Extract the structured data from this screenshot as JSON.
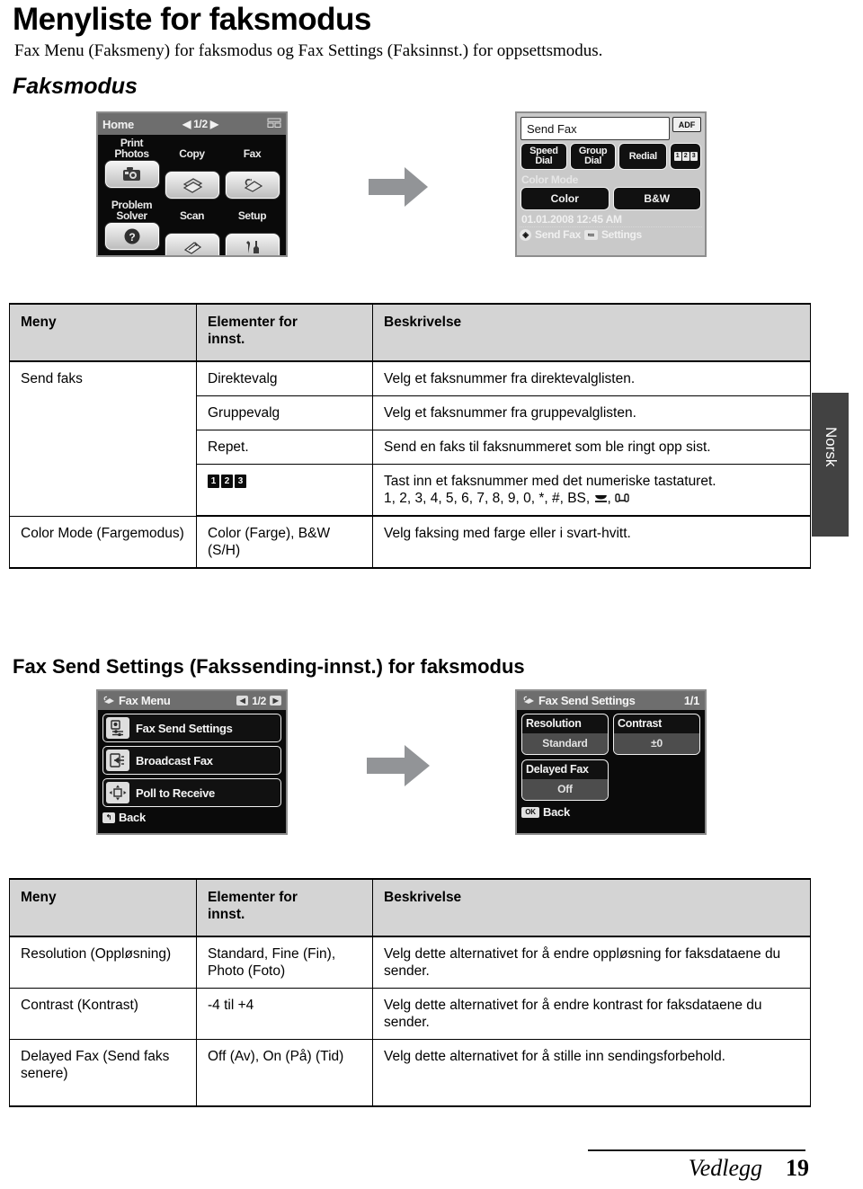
{
  "document": {
    "title": "Menyliste for faksmodus",
    "subtitle": "Fax Menu (Faksmeny) for faksmodus og Fax Settings (Faksinnst.) for oppsettsmodus.",
    "section1_heading": "Faksmodus",
    "section2_heading": "Fax Send Settings (Fakssending-innst.) for faksmodus",
    "side_tab": "Norsk",
    "footer": {
      "label": "Vedlegg",
      "page": "19"
    }
  },
  "lcd_home": {
    "title": "Home",
    "page_indicator": "1/2",
    "prev_arrow": "◀",
    "next_arrow": "▶",
    "items": [
      {
        "label": "Print\nPhotos",
        "icon": "print-photos-icon"
      },
      {
        "label": "Copy",
        "icon": "copy-icon"
      },
      {
        "label": "Fax",
        "icon": "fax-icon"
      },
      {
        "label": "Problem\nSolver",
        "icon": "problem-solver-icon"
      },
      {
        "label": "Scan",
        "icon": "scan-icon"
      },
      {
        "label": "Setup",
        "icon": "setup-icon"
      }
    ]
  },
  "lcd_sendfax": {
    "field_value": "Send Fax",
    "adf_badge": "ADF",
    "keys": [
      {
        "label": "Speed\nDial"
      },
      {
        "label": "Group\nDial"
      },
      {
        "label": "Redial"
      },
      {
        "label": "123"
      }
    ],
    "color_mode_label": "Color Mode",
    "modes": [
      "Color",
      "B&W"
    ],
    "datetime": "01.01.2008  12:45 AM",
    "status_send": "Send Fax",
    "status_settings": "Settings"
  },
  "lcd_faxmenu": {
    "title": "Fax Menu",
    "page_indicator": "1/2",
    "prev_arrow": "◀",
    "next_arrow": "▶",
    "items": [
      {
        "label": "Fax Send Settings",
        "icon": "fax-send-settings-icon"
      },
      {
        "label": "Broadcast Fax",
        "icon": "broadcast-fax-icon"
      },
      {
        "label": "Poll to Receive",
        "icon": "poll-to-receive-icon"
      }
    ],
    "back_label": "Back"
  },
  "lcd_fss": {
    "title": "Fax Send Settings",
    "page_indicator": "1/1",
    "settings": [
      {
        "name": "Resolution",
        "value": "Standard"
      },
      {
        "name": "Contrast",
        "value": "±0"
      },
      {
        "name": "Delayed Fax",
        "value": "Off"
      }
    ],
    "back_label": "Back",
    "back_key": "OK"
  },
  "table1": {
    "headers": [
      "Meny",
      "Elementer for innst.",
      "Beskrivelse"
    ],
    "rows": [
      {
        "menu": "Send faks",
        "item": "Direktevalg",
        "description": "Velg et faksnummer fra direktevalglisten."
      },
      {
        "menu": "",
        "item": "Gruppevalg",
        "description": "Velg et faksnummer fra gruppevalglisten."
      },
      {
        "menu": "",
        "item": "Repet.",
        "description": "Send en faks til faksnummeret som ble ringt opp sist."
      },
      {
        "menu": "",
        "item": "123",
        "item_is_keypad_icon": true,
        "description": "Tast inn et faksnummer med det numeriske tastaturet.",
        "description_line2": "1, 2, 3, 4, 5, 6, 7, 8, 9, 0, *, #, BS,"
      },
      {
        "menu": "Color Mode (Fargemodus)",
        "item": "Color (Farge), B&W (S/H)",
        "description": "Velg faksing med farge eller i svart-hvitt."
      }
    ]
  },
  "table2": {
    "headers": [
      "Meny",
      "Elementer for innst.",
      "Beskrivelse"
    ],
    "rows": [
      {
        "menu": "Resolution (Oppløsning)",
        "item": "Standard, Fine (Fin), Photo (Foto)",
        "description": "Velg dette alternativet for å endre oppløsning for faksdataene du sender."
      },
      {
        "menu": "Contrast (Kontrast)",
        "item": "-4 til +4",
        "description": "Velg dette alternativet for å endre kontrast for faksdataene du sender."
      },
      {
        "menu": "Delayed Fax (Send faks senere)",
        "item": "Off (Av), On (På) (Tid)",
        "description": "Velg dette alternativet for å stille inn sendingsforbehold."
      }
    ]
  },
  "colors": {
    "table_header_bg": "#d4d4d4",
    "lcd_dark_bg": "#0a0a0a",
    "lcd_light_bg": "#c9c9c9",
    "lcd_titlebar_bg": "#6e6e6e",
    "arrow_gray": "#929497",
    "side_tab_bg": "#424242"
  }
}
